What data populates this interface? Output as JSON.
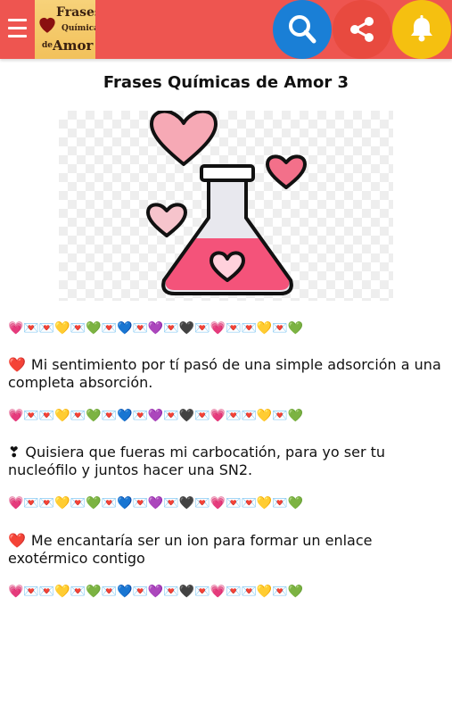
{
  "app": {
    "logo_text": [
      "Frases",
      "Químicas",
      "de",
      "Amor"
    ]
  },
  "header": {
    "icons": [
      "menu-icon",
      "search-icon",
      "share-icon",
      "bell-icon"
    ],
    "colors": {
      "bar": "#ee5550",
      "search": "#1a7fd6",
      "share": "#e84a3f",
      "bell": "#f5c010"
    }
  },
  "page": {
    "title": "Frases Químicas de Amor 3",
    "divider": "💗💌💌💛💌💚💌💙💌💜💌🖤💌💗💌💌💛💌💚"
  },
  "phrases": [
    {
      "mark": "❤️",
      "text": "Mi sentimiento por tí pasó de una simple adsorción a una completa absorción."
    },
    {
      "mark": "❣",
      "text": "Quisiera que fueras mi carbocatión, para yo ser tu nucleófilo y juntos hacer una SN2."
    },
    {
      "mark": "❤️",
      "text": "Me encantaría ser un ion para formar un enlace exotérmico contigo"
    }
  ]
}
